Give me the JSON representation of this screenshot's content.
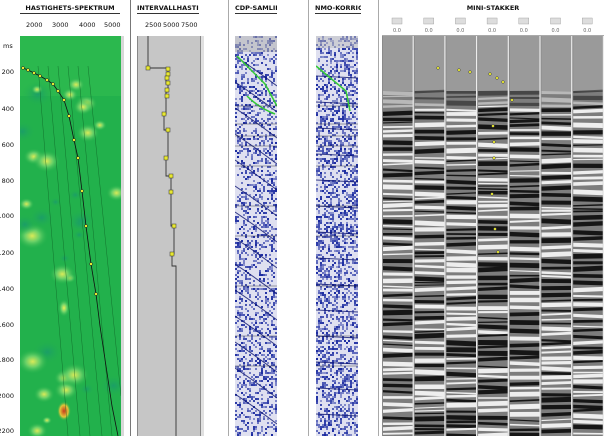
{
  "panels": {
    "velocity_spectrum": {
      "title": "HASTIGHETS-SPEKTRUM",
      "x_ticks": [
        "2000",
        "3000",
        "4000",
        "5000"
      ],
      "unit": "ms",
      "y_ticks": [
        "200",
        "400",
        "600",
        "800",
        "1000",
        "1200",
        "1400",
        "1600",
        "1800",
        "2000",
        "2200"
      ]
    },
    "interval_velocity": {
      "title": "INTERVALLHASTIGHET",
      "x_ticks": [
        "2500",
        "5000",
        "7500"
      ]
    },
    "cdp_gather": {
      "title": "CDP-SAMLING"
    },
    "nmo_corrected": {
      "title": "NMO-KORRIGERT"
    },
    "mini_stacks": {
      "title": "MINI-STAKKER"
    }
  },
  "colors": {
    "spectrum_bg": "#22b14c",
    "spectrum_hot": "#f5e642",
    "interval_bg": "#c6c6c6",
    "pick": "#e8e830",
    "gather_blue": "#1a2aa0",
    "pick_line": "#33cc33"
  }
}
